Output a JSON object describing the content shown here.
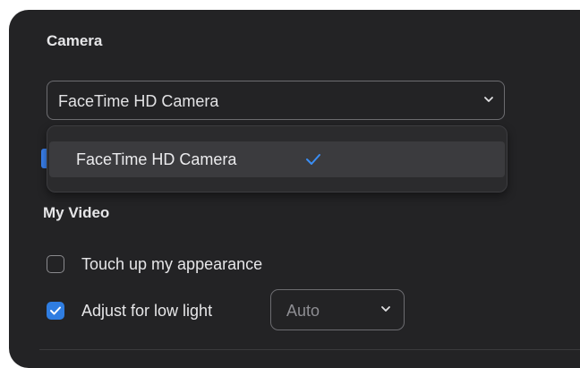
{
  "camera_section": {
    "title": "Camera",
    "selected_camera": "FaceTime HD Camera",
    "dropdown_open": true,
    "options": [
      {
        "label": "FaceTime HD Camera",
        "checked": true
      }
    ]
  },
  "my_video_section": {
    "title": "My Video",
    "touch_up": {
      "label": "Touch up my appearance",
      "checked": false
    },
    "low_light": {
      "label": "Adjust for low light",
      "checked": true,
      "mode": "Auto"
    }
  },
  "icons": {
    "dropdown_chevron": "chevron-down-icon",
    "selected_check": "checkmark-icon",
    "checkbox_check": "checkmark-icon"
  },
  "colors": {
    "panel_bg": "#232325",
    "accent": "#2f7de1",
    "text": "#e6e6e8",
    "muted_text": "#8e8e93"
  }
}
